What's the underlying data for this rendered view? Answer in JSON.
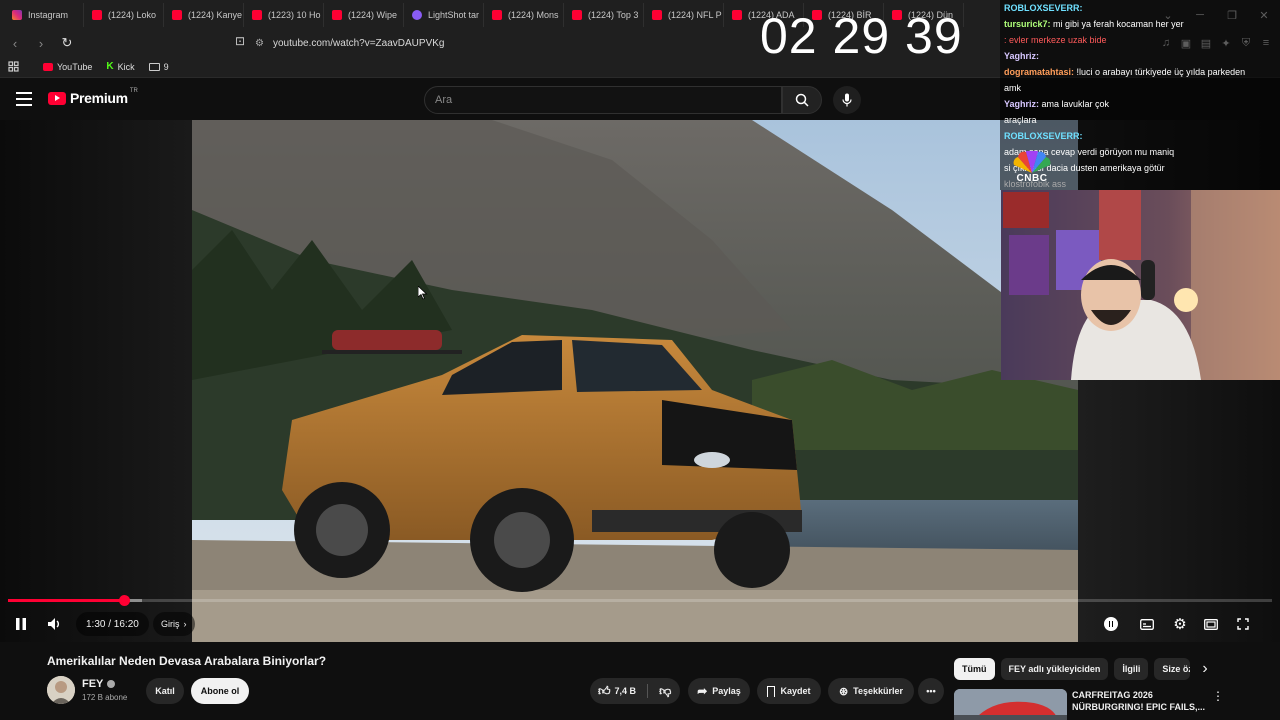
{
  "browser": {
    "tabs": [
      {
        "label": "Instagram",
        "icon": "instagram-icon"
      },
      {
        "label": "(1224) Loko",
        "icon": "youtube-icon"
      },
      {
        "label": "(1224) Kanye",
        "icon": "youtube-icon"
      },
      {
        "label": "(1223) 10 Ho",
        "icon": "youtube-icon"
      },
      {
        "label": "(1224) Wipe",
        "icon": "youtube-icon"
      },
      {
        "label": "LightShot tar",
        "icon": "lightshot-icon"
      },
      {
        "label": "(1224) Mons",
        "icon": "youtube-icon"
      },
      {
        "label": "(1224) Top 3",
        "icon": "youtube-icon"
      },
      {
        "label": "(1224) NFL P",
        "icon": "youtube-icon"
      },
      {
        "label": "(1224) ADA",
        "icon": "youtube-icon"
      },
      {
        "label": "(1224) BİR",
        "icon": "youtube-icon"
      },
      {
        "label": "(1224) Dün",
        "icon": "youtube-icon"
      }
    ],
    "url": "youtube.com/watch?v=ZaavDAUPVKg",
    "bookmarks": [
      {
        "label": "YouTube"
      },
      {
        "label": "Kick"
      },
      {
        "label": "9"
      }
    ]
  },
  "overlay": {
    "clock": "02 29 39",
    "cnbc": "CNBC",
    "chat": [
      {
        "user": "ROBLOXSEVERR:",
        "text": "",
        "color": "#6fe0ff"
      },
      {
        "user": "tursurick7:",
        "text": "mi gibi ya ferah kocaman her yer",
        "color": "#b0ff7a"
      },
      {
        "user": "",
        "text": ": evler merkeze uzak bide",
        "color": "#ff5a5a"
      },
      {
        "user": "Yaghriz:",
        "text": "",
        "color": "#d7c7ff"
      },
      {
        "user": "dogramatahtasi:",
        "text": "!luci o arabayı türkiyede üç yılda parkeden",
        "color": "#ff9d5a"
      },
      {
        "user": "",
        "text": "amk",
        "color": "#ffffff"
      },
      {
        "user": "Yaghriz:",
        "text": "ama lavuklar çok",
        "color": "#d7c7ff"
      },
      {
        "user": "",
        "text": "araçlara",
        "color": "#ffffff"
      },
      {
        "user": "ROBLOXSEVERR:",
        "text": "",
        "color": "#6fe0ff"
      },
      {
        "user": "",
        "text": "adam sana cevap verdi görüyon mu maniq",
        "color": "#ffffff"
      },
      {
        "user": "",
        "text": "si çıkması dacia dusten amerikaya götür",
        "color": "#ffffff"
      },
      {
        "user": "",
        "text": "klostrofobik ass",
        "color": "#aaaaaa"
      }
    ]
  },
  "youtube": {
    "brand": "Premium",
    "region": "TR",
    "search_placeholder": "Ara",
    "player": {
      "time": "1:30 / 16:20",
      "chapter": "Giriş",
      "progress_fraction": 0.092,
      "buffer_fraction": 0.106
    },
    "video_title": "Amerikalılar Neden Devasa Arabalara Biniyorlar?",
    "channel": {
      "name": "FEY",
      "subscribers": "172 B abone"
    },
    "join_label": "Katıl",
    "subscribe_label": "Abone ol",
    "likes": "7,4 B",
    "share_label": "Paylaş",
    "save_label": "Kaydet",
    "thanks_label": "Teşekkürler",
    "chips": [
      "Tümü",
      "FEY adlı yükleyiciden",
      "İlgili",
      "Size öz"
    ],
    "recommended": {
      "title_line1": "CARFREITAG 2026",
      "title_line2": "NÜRBURGRING! EPIC FAILS,..."
    }
  },
  "colors": {
    "accent": "#ff0033",
    "background": "#0f0f0f",
    "surface": "#272727"
  }
}
